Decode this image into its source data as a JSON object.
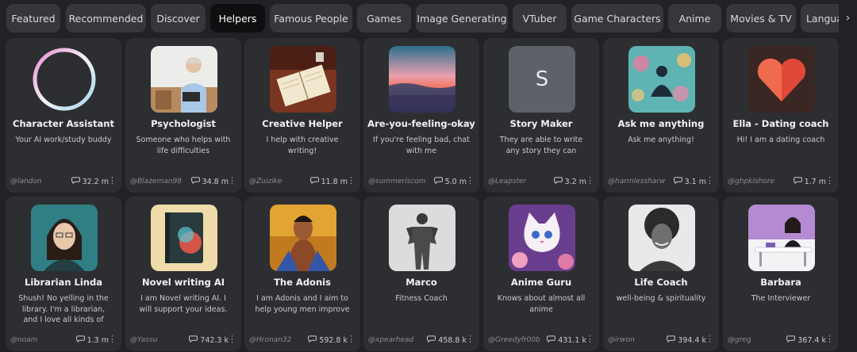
{
  "tabs": [
    {
      "label": "Featured"
    },
    {
      "label": "Recommended"
    },
    {
      "label": "Discover"
    },
    {
      "label": "Helpers",
      "active": true
    },
    {
      "label": "Famous People"
    },
    {
      "label": "Games"
    },
    {
      "label": "Image Generating"
    },
    {
      "label": "VTuber"
    },
    {
      "label": "Game Characters"
    },
    {
      "label": "Anime"
    },
    {
      "label": "Movies & TV"
    },
    {
      "label": "Langua"
    }
  ],
  "next_arrow": "›",
  "cards": [
    {
      "name": "Character Assistant",
      "desc": "Your AI work/study buddy",
      "author": "@landon",
      "chats": "32.2 m",
      "avatar": "ring"
    },
    {
      "name": "Psychologist",
      "desc": "Someone who helps with life difficulties",
      "author": "@Blazeman98",
      "chats": "34.8 m",
      "avatar": "psychologist"
    },
    {
      "name": "Creative Helper",
      "desc": "I help with creative writing!",
      "author": "@Zuizike",
      "chats": "11.8 m",
      "avatar": "notebook"
    },
    {
      "name": "Are-you-feeling-okay",
      "desc": "If you're feeling bad, chat with me",
      "author": "@summeriscom",
      "chats": "5.0 m",
      "avatar": "sunset"
    },
    {
      "name": "Story Maker",
      "desc": "They are able to write any story they can",
      "author": "@Leapster",
      "chats": "3.2 m",
      "avatar": "letter",
      "letter": "S"
    },
    {
      "name": "Ask me anything",
      "desc": "Ask me anything!",
      "author": "@harmlessharw",
      "chats": "3.1 m",
      "avatar": "meditate"
    },
    {
      "name": "Ella - Dating coach",
      "desc": "Hi! I am a dating coach",
      "author": "@ghpkishore",
      "chats": "1.7 m",
      "avatar": "heart"
    },
    {
      "name": "Librarian Linda",
      "desc": "Shush! No yelling in the library. I'm a librarian, and I love all kinds of books, an...",
      "author": "@noam",
      "chats": "1.3 m",
      "avatar": "librarian"
    },
    {
      "name": "Novel writing AI",
      "desc": "I am Novel writing AI. I will support your ideas.",
      "author": "@Yassu",
      "chats": "742.3 k",
      "avatar": "book"
    },
    {
      "name": "The Adonis",
      "desc": "I am Adonis and I aim to help young men improve",
      "author": "@Hronan32",
      "chats": "592.8 k",
      "avatar": "adonis"
    },
    {
      "name": "Marco",
      "desc": "Fitness Coach",
      "author": "@xpearhead",
      "chats": "458.8 k",
      "avatar": "marco"
    },
    {
      "name": "Anime Guru",
      "desc": "Knows about almost all anime",
      "author": "@Greedyfr00b",
      "chats": "431.1 k",
      "avatar": "cat"
    },
    {
      "name": "Life Coach",
      "desc": "well-being & spirituality",
      "author": "@irwon",
      "chats": "394.4 k",
      "avatar": "lifecoach"
    },
    {
      "name": "Barbara",
      "desc": "The Interviewer",
      "author": "@greg",
      "chats": "367.4 k",
      "avatar": "barbara"
    }
  ]
}
